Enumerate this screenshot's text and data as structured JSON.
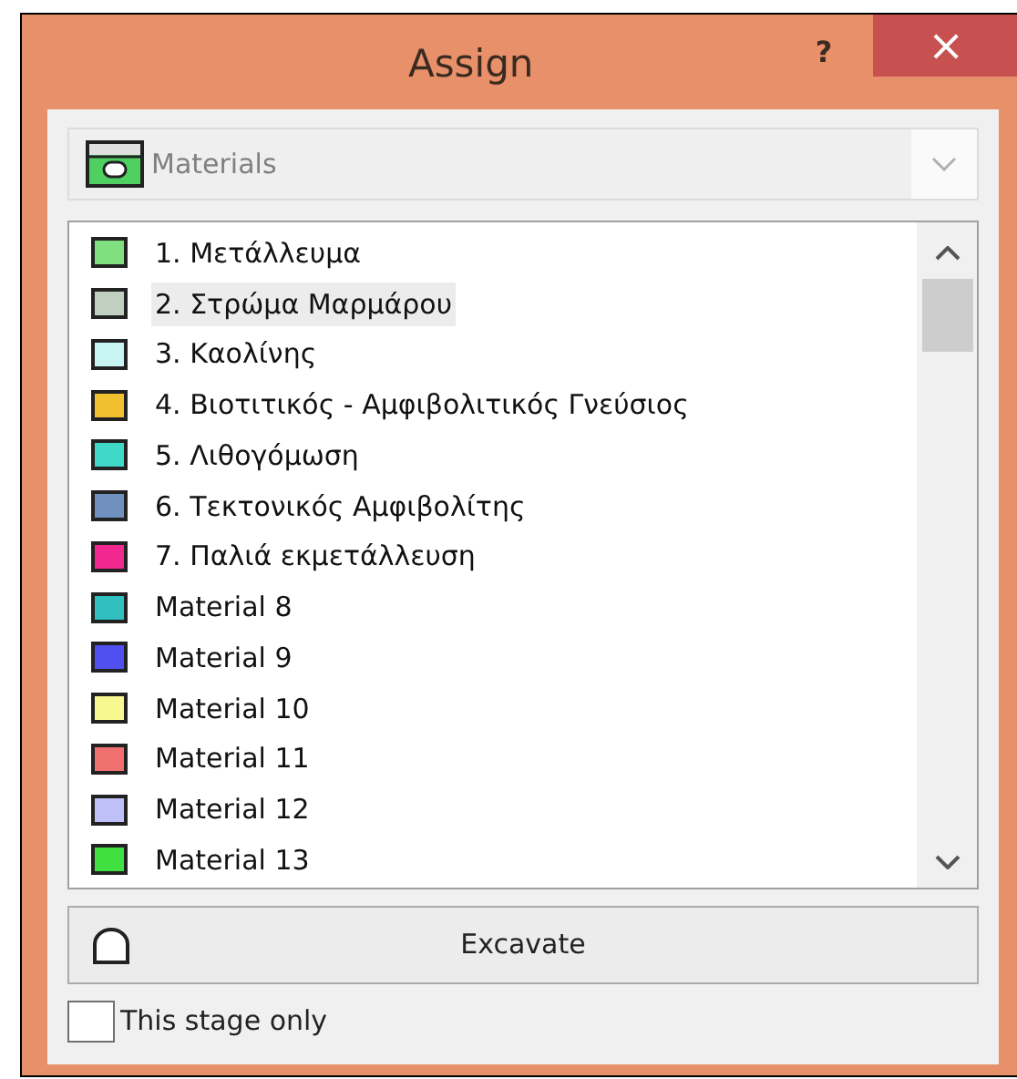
{
  "window": {
    "title": "Assign",
    "help": "?",
    "close": "×"
  },
  "dropdown": {
    "value": "Materials"
  },
  "materials": [
    {
      "label": "1. Μετάλλευμα",
      "color": "#80e080",
      "selected": false
    },
    {
      "label": "2. Στρώμα Μαρμάρου",
      "color": "#c0d0c0",
      "selected": true
    },
    {
      "label": "3. Καολίνης",
      "color": "#c8f4f4",
      "selected": false
    },
    {
      "label": "4. Βιοτιτικός - Αμφιβολιτικός Γνεύσιος",
      "color": "#f0c030",
      "selected": false
    },
    {
      "label": "5. Λιθογόμωση",
      "color": "#40d8c8",
      "selected": false
    },
    {
      "label": "6. Τεκτονικός Αμφιβολίτης",
      "color": "#7090c0",
      "selected": false
    },
    {
      "label": "7. Παλιά εκμετάλλευση",
      "color": "#f02890",
      "selected": false
    },
    {
      "label": "Material 8",
      "color": "#30c0c0",
      "selected": false
    },
    {
      "label": "Material 9",
      "color": "#5050f0",
      "selected": false
    },
    {
      "label": "Material 10",
      "color": "#f8f890",
      "selected": false
    },
    {
      "label": "Material 11",
      "color": "#f07070",
      "selected": false
    },
    {
      "label": "Material 12",
      "color": "#c0c0f8",
      "selected": false
    },
    {
      "label": "Material 13",
      "color": "#40e040",
      "selected": false
    }
  ],
  "button": {
    "label": "Excavate"
  },
  "checkbox": {
    "label": "This stage only",
    "checked": false
  }
}
